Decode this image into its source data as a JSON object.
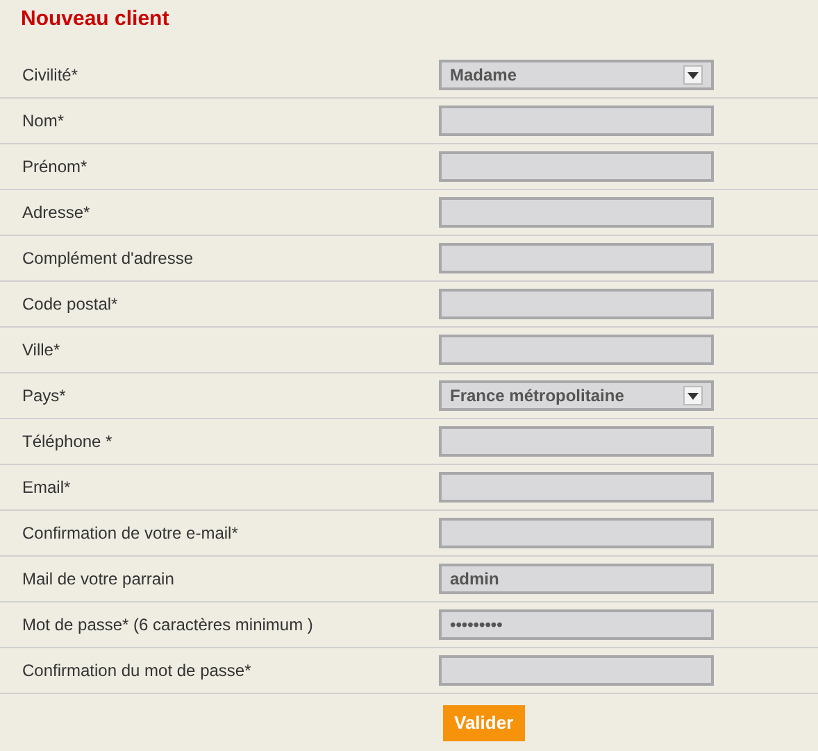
{
  "title": "Nouveau client",
  "fields": [
    {
      "label": "Civilité*",
      "kind": "select",
      "value": "Madame"
    },
    {
      "label": "Nom*",
      "kind": "text"
    },
    {
      "label": "Prénom*",
      "kind": "text"
    },
    {
      "label": "Adresse*",
      "kind": "text"
    },
    {
      "label": "Complément d'adresse",
      "kind": "text"
    },
    {
      "label": "Code postal*",
      "kind": "text"
    },
    {
      "label": "Ville*",
      "kind": "text"
    },
    {
      "label": "Pays*",
      "kind": "select",
      "value": "France métropolitaine"
    },
    {
      "label": "Téléphone *",
      "kind": "text"
    },
    {
      "label": "Email*",
      "kind": "text"
    },
    {
      "label": "Confirmation de votre e-mail*",
      "kind": "text"
    },
    {
      "label": "Mail de votre parrain",
      "kind": "text",
      "value": "admin"
    },
    {
      "label": "Mot de passe* (6 caractères minimum )",
      "kind": "password",
      "value": "•••••••••"
    },
    {
      "label": "Confirmation du mot de passe*",
      "kind": "password"
    }
  ],
  "submit": "Valider"
}
